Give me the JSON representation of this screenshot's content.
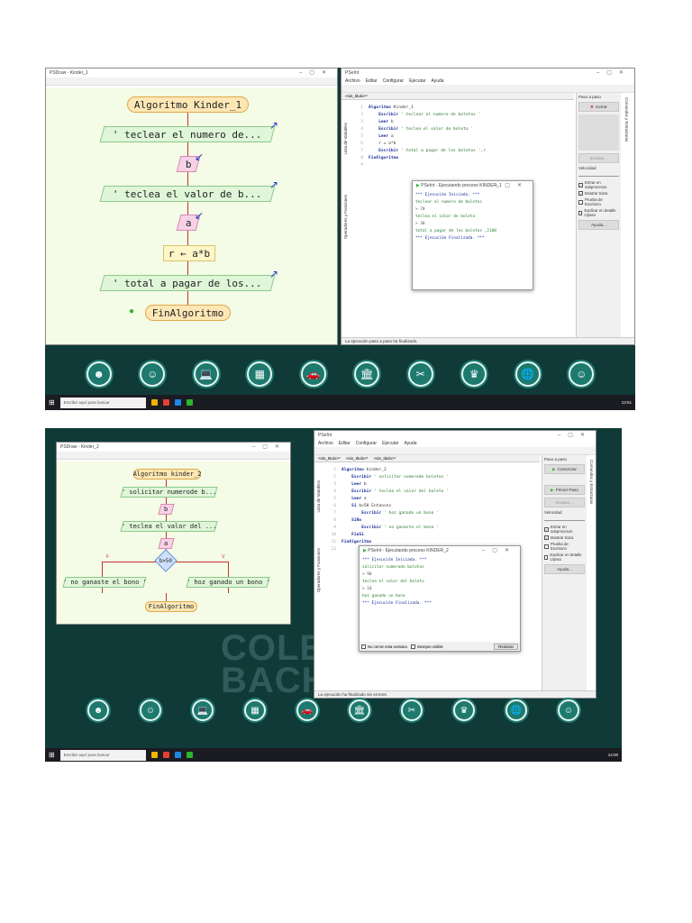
{
  "shot1": {
    "flow": {
      "title": "PSDraw - Kinder_1",
      "nodes": {
        "start": "Algoritmo Kinder_1",
        "out1": "' teclear el numero de...",
        "in1": "b",
        "out2": "' teclea el valor de b...",
        "in2": "a",
        "assign": "r ← a*b",
        "out3": "' total a pagar de los...",
        "end": "FinAlgoritmo"
      }
    },
    "pseint": {
      "title": "PSeInt",
      "menus": [
        "Archivo",
        "Editar",
        "Configurar",
        "Ejecutar",
        "Ayuda"
      ],
      "tabs": [
        "<sin_titulo>*"
      ],
      "code": [
        [
          "Algoritmo",
          " Kinder_1"
        ],
        [
          "    Escribir",
          " ' teclear el numero de boletos '"
        ],
        [
          "    Leer",
          " b"
        ],
        [
          "    Escribir",
          " ' teclea el valor de boleto '"
        ],
        [
          "    Leer",
          " a"
        ],
        [
          "",
          "    r = a*b"
        ],
        [
          "    Escribir",
          " ' total a pagar de los boletos ',r"
        ],
        [
          "FinAlgoritmo",
          ""
        ],
        [
          "",
          ""
        ]
      ],
      "panel": {
        "title": "Paso a paso",
        "close_label": "Cerrar",
        "evaluate_label": "Evaluar...",
        "speed_label": "Velocidad",
        "checkboxes": [
          {
            "label": "Entrar en subprocesos",
            "checked": true
          },
          {
            "label": "Mostrar traza",
            "checked": true
          },
          {
            "label": "Prueba de Escritorio",
            "checked": false
          },
          {
            "label": "Explicar en detalle c/paso",
            "checked": false
          }
        ],
        "help_label": "Ayuda..."
      },
      "side_tabs": [
        "Lista de Variables",
        "Operadores y Funciones"
      ],
      "right_tab": "Comandos y Estructuras",
      "status": "La ejecución paso a paso ha finalizado."
    },
    "console": {
      "title": "PSeInt - Ejecutando proceso KINDER_1",
      "lines": [
        {
          "t": "*** Ejecución Iniciada. ***",
          "k": "sys"
        },
        {
          "t": " teclear el numero de boletos",
          "k": "out"
        },
        {
          "t": "> 70",
          "k": "usr"
        },
        {
          "t": " teclea el valor de boleto",
          "k": "out"
        },
        {
          "t": "> 30",
          "k": "usr"
        },
        {
          "t": " total a pagar de los boletos ,2100",
          "k": "out"
        },
        {
          "t": "*** Ejecución Finalizada. ***",
          "k": "sys"
        }
      ]
    },
    "taskbar": {
      "search_placeholder": "Escribir aquí para buscar",
      "time": "13:51"
    }
  },
  "shot2": {
    "flow": {
      "title": "PSDraw - Kinder_2",
      "nodes": {
        "start": "Algoritmo kinder_2",
        "out1": "' solicitar numerode b...",
        "in1": "b",
        "out2": "' teclea el valor del ...",
        "in2": "a",
        "cond": "b>50",
        "false_label": "F",
        "true_label": "V",
        "out_f": "' no ganaste el bono '",
        "out_v": "' hoz ganado un bono '",
        "end": "FinAlgoritmo"
      }
    },
    "pseint": {
      "title": "PSeInt",
      "menus": [
        "Archivo",
        "Editar",
        "Configurar",
        "Ejecutar",
        "Ayuda"
      ],
      "tabs": [
        "<sin_titulo>*",
        "<sin_titulo>*",
        "<sin_titulo>*"
      ],
      "code": [
        [
          "Algoritmo",
          " kinder_2"
        ],
        [
          "    Escribir",
          " ' solicitar numerode boletos '"
        ],
        [
          "    Leer",
          " b"
        ],
        [
          "    Escribir",
          " ' teclea el valor del boleto '"
        ],
        [
          "    Leer",
          " a"
        ],
        [
          "    Si",
          " b>50 Entonces"
        ],
        [
          "        Escribir",
          " ' hoz ganado un bono '"
        ],
        [
          "    SiNo",
          ""
        ],
        [
          "        Escribir",
          " ' no ganaste el bono '"
        ],
        [
          "    FinSi",
          ""
        ],
        [
          "FinAlgoritmo",
          ""
        ],
        [
          "",
          ""
        ]
      ],
      "panel": {
        "title": "Paso a paso",
        "start_label": "Comenzar",
        "first_step_label": "Primer Paso",
        "evaluate_label": "Evaluar...",
        "speed_label": "Velocidad",
        "checkboxes": [
          {
            "label": "Entrar en subprocesos",
            "checked": true
          },
          {
            "label": "Mostrar traza",
            "checked": true
          },
          {
            "label": "Prueba de Escritorio",
            "checked": false
          },
          {
            "label": "Explicar en detalle c/paso",
            "checked": false
          }
        ],
        "help_label": "Ayuda..."
      },
      "side_tabs": [
        "Lista de Variables",
        "Operadores y Funciones"
      ],
      "right_tab": "Comandos y Estructuras",
      "status": "La ejecución ha finalizado sin errores."
    },
    "console": {
      "title": "PSeInt - Ejecutando proceso KINDER_2",
      "lines": [
        {
          "t": "*** Ejecución Iniciada. ***",
          "k": "sys"
        },
        {
          "t": " solicitar numerode boletos",
          "k": "out"
        },
        {
          "t": "> 90",
          "k": "usr"
        },
        {
          "t": " teclea el valor del boleto",
          "k": "out"
        },
        {
          "t": "> 10",
          "k": "usr"
        },
        {
          "t": " hoz ganado un bono",
          "k": "out"
        },
        {
          "t": "*** Ejecución Finalizada. ***",
          "k": "sys"
        }
      ],
      "no_close_label": "No cerrar esta ventana",
      "always_visible_label": "Siempre visible",
      "restart_label": "Reiniciar"
    },
    "watermark": [
      "COLE",
      "BACH"
    ],
    "taskbar": {
      "search_placeholder": "Escribir aquí para buscar",
      "time": "14:00"
    }
  },
  "dock_icons": [
    "people-icon",
    "head-icon",
    "laptop-icon",
    "chart-icon",
    "car-icon",
    "building-icon",
    "tools-icon",
    "crown-icon",
    "globe-icon",
    "face-icon"
  ],
  "colors": {
    "desktop": "#0f3a38",
    "dock": "#1e7a6e",
    "flow_bg": "#f4fbe6"
  }
}
